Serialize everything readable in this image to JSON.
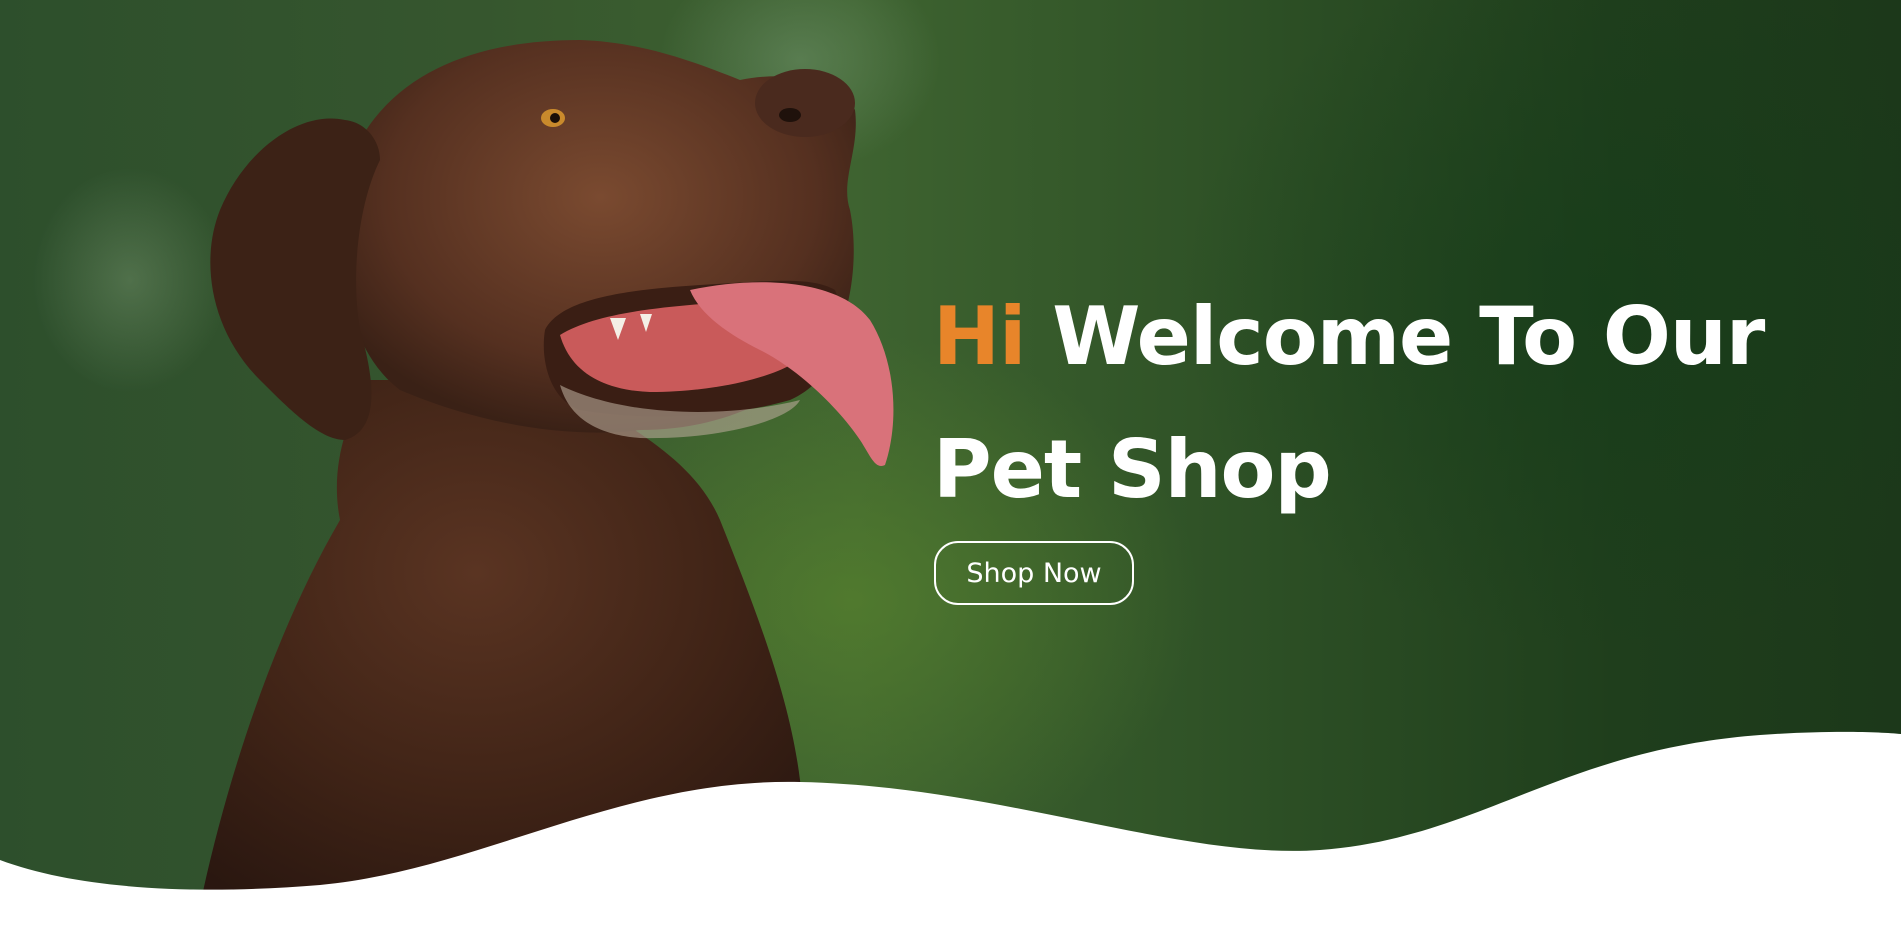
{
  "hero": {
    "headline_accent": "Hi",
    "headline_line1": "Welcome To Our",
    "headline_line2": "Pet Shop",
    "cta_label": "Shop Now",
    "image": "chocolate-labrador-dog-photo"
  },
  "colors": {
    "accent": "#e8852a",
    "text": "#ffffff",
    "background_green": "#2e5126",
    "wave_fill": "#ffffff"
  }
}
